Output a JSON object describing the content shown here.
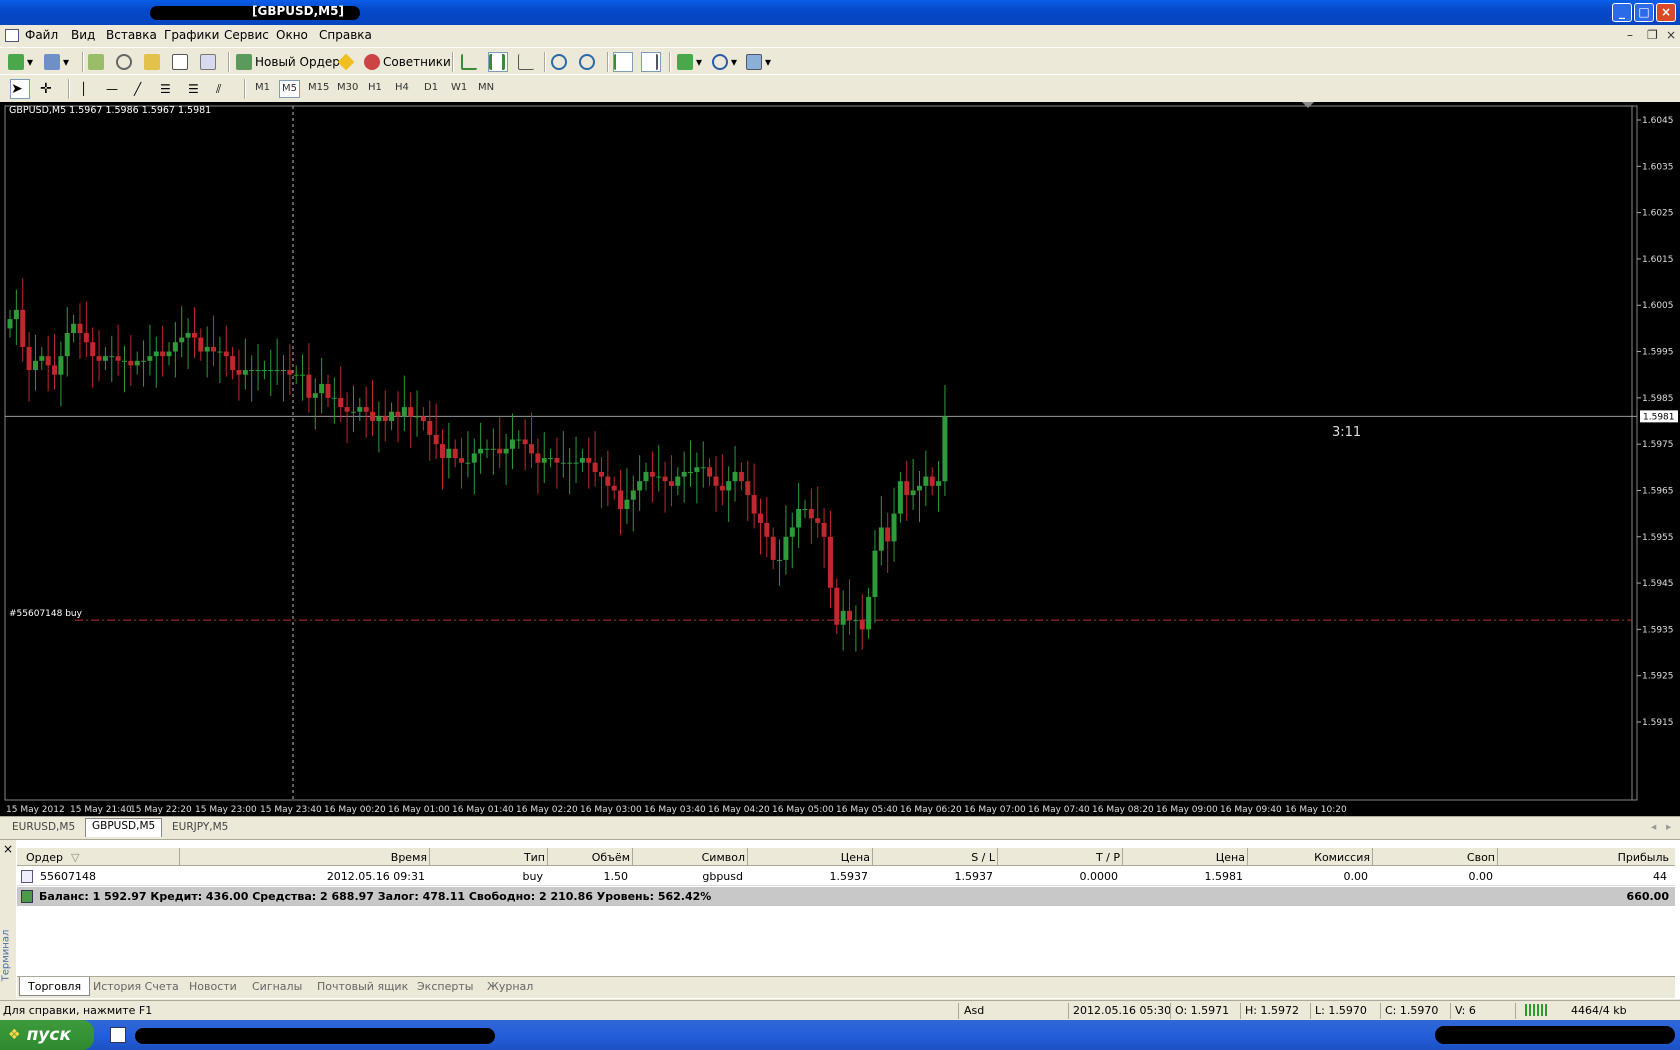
{
  "window": {
    "title": "[GBPUSD,M5]"
  },
  "menu": [
    "Файл",
    "Вид",
    "Вставка",
    "Графики",
    "Сервис",
    "Окно",
    "Справка"
  ],
  "toolbar": {
    "new_order": "Новый Ордер",
    "advisors": "Советники"
  },
  "timeframes": [
    "M1",
    "M5",
    "M15",
    "M30",
    "H1",
    "H4",
    "D1",
    "W1",
    "MN"
  ],
  "chart": {
    "header": "GBPUSD,M5  1.5967 1.5986 1.5967 1.5981",
    "order_label": "#55607148 buy",
    "countdown": "3:11",
    "current_price": "1.5981",
    "order_price": 1.5937
  },
  "chart_data": {
    "type": "candlestick",
    "title": "GBPUSD,M5",
    "y_ticks": [
      "1.6045",
      "1.6035",
      "1.6025",
      "1.6015",
      "1.6005",
      "1.5995",
      "1.5985",
      "1.5975",
      "1.5965",
      "1.5955",
      "1.5945",
      "1.5935",
      "1.5925",
      "1.5915"
    ],
    "ylim": [
      1.591,
      1.605
    ],
    "x_ticks": [
      "15 May 2012",
      "15 May 21:40",
      "15 May 22:20",
      "15 May 23:00",
      "15 May 23:40",
      "16 May 00:20",
      "16 May 01:00",
      "16 May 01:40",
      "16 May 02:20",
      "16 May 03:00",
      "16 May 03:40",
      "16 May 04:20",
      "16 May 05:00",
      "16 May 05:40",
      "16 May 06:20",
      "16 May 07:00",
      "16 May 07:40",
      "16 May 08:20",
      "16 May 09:00",
      "16 May 09:40",
      "16 May 10:20"
    ],
    "close": [
      1.6002,
      1.6004,
      1.5996,
      1.5991,
      1.5993,
      1.5994,
      1.5992,
      1.599,
      1.5994,
      1.5999,
      1.6001,
      1.5999,
      1.5997,
      1.5994,
      1.5993,
      1.5994,
      1.5994,
      1.5993,
      1.5993,
      1.5992,
      1.5993,
      1.5993,
      1.5994,
      1.5995,
      1.5994,
      1.5995,
      1.5997,
      1.5998,
      1.5999,
      1.5998,
      1.5995,
      1.5996,
      1.5995,
      1.5995,
      1.5994,
      1.5991,
      1.599,
      1.5991,
      1.5991,
      1.5991,
      1.5991,
      1.5991,
      1.5991,
      1.5991,
      1.599,
      1.599,
      1.599,
      1.5985,
      1.5986,
      1.5988,
      1.5985,
      1.5985,
      1.5983,
      1.5982,
      1.5982,
      1.5983,
      1.5982,
      1.598,
      1.5981,
      1.598,
      1.5982,
      1.5981,
      1.5983,
      1.5981,
      1.5981,
      1.598,
      1.5977,
      1.5975,
      1.5972,
      1.5974,
      1.5972,
      1.5971,
      1.5971,
      1.5973,
      1.5974,
      1.5974,
      1.5974,
      1.5973,
      1.5974,
      1.5976,
      1.5976,
      1.5975,
      1.5973,
      1.5971,
      1.5972,
      1.5972,
      1.5971,
      1.5971,
      1.5971,
      1.5971,
      1.5972,
      1.5971,
      1.5969,
      1.5968,
      1.5966,
      1.5965,
      1.5961,
      1.5963,
      1.5965,
      1.5967,
      1.5969,
      1.5968,
      1.5968,
      1.5967,
      1.5966,
      1.5968,
      1.5969,
      1.5969,
      1.597,
      1.597,
      1.5968,
      1.5966,
      1.5965,
      1.5967,
      1.5969,
      1.5967,
      1.5964,
      1.596,
      1.5958,
      1.5955,
      1.595,
      1.595,
      1.5955,
      1.5957,
      1.5961,
      1.5961,
      1.5959,
      1.5958,
      1.5955,
      1.5944,
      1.5936,
      1.5939,
      1.5937,
      1.5937,
      1.5935,
      1.5942,
      1.5952,
      1.5957,
      1.5954,
      1.596,
      1.5967,
      1.5964,
      1.5965,
      1.5966,
      1.5968,
      1.5966,
      1.5967,
      1.5981
    ],
    "order_line": 1.5937
  },
  "chart_tabs": [
    "EURUSD,M5",
    "GBPUSD,M5",
    "EURJPY,M5"
  ],
  "terminal": {
    "side_label": "Терминал",
    "columns": [
      "Ордер",
      "Время",
      "Тип",
      "Объём",
      "Символ",
      "Цена",
      "S / L",
      "T / P",
      "Цена",
      "Комиссия",
      "Своп",
      "Прибыль"
    ],
    "rows": [
      [
        "55607148",
        "2012.05.16 09:31",
        "buy",
        "1.50",
        "gbpusd",
        "1.5937",
        "1.5937",
        "0.0000",
        "1.5981",
        "0.00",
        "0.00",
        "44"
      ]
    ],
    "balance": "Баланс: 1 592.97  Кредит: 436.00  Средства: 2 688.97  Залог: 478.11  Свободно: 2 210.86  Уровень: 562.42%",
    "balance_total": "660.00",
    "tabs": [
      "Торговля",
      "История Счета",
      "Новости",
      "Сигналы",
      "Почтовый ящик",
      "Эксперты",
      "Журнал"
    ]
  },
  "status": {
    "help": "Для справки, нажмите F1",
    "profile": "Asd",
    "time": "2012.05.16 05:30",
    "open": "O: 1.5971",
    "high": "H: 1.5972",
    "low": "L: 1.5970",
    "close": "C: 1.5970",
    "volume": "V: 6",
    "traffic": "4464/4 kb"
  },
  "taskbar": {
    "start": "пуск"
  }
}
